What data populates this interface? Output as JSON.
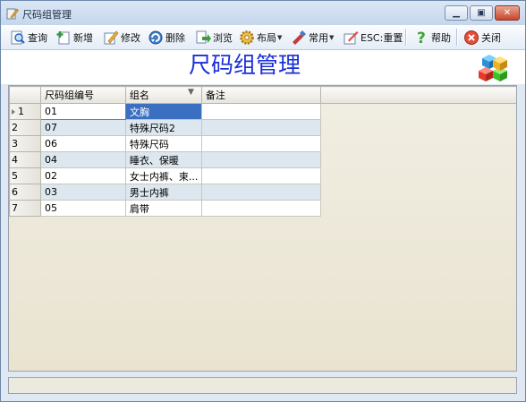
{
  "window": {
    "title": "尺码组管理",
    "app_icon": "pencil-icon"
  },
  "toolbar": {
    "items": [
      {
        "label": "查询",
        "icon": "query-icon"
      },
      {
        "label": "新增",
        "icon": "add-icon"
      },
      {
        "label": "修改",
        "icon": "edit-icon"
      },
      {
        "label": "删除",
        "icon": "delete-icon"
      },
      {
        "label": "浏览",
        "icon": "browse-icon"
      },
      {
        "label": "布局",
        "icon": "layout-gear-icon"
      },
      {
        "label": "常用",
        "icon": "common-icon"
      },
      {
        "label": "ESC:重置",
        "icon": "reset-icon"
      },
      {
        "label": "帮助",
        "icon": "help-icon"
      },
      {
        "label": "关闭",
        "icon": "close-icon"
      }
    ]
  },
  "header": {
    "title": "尺码组管理",
    "logo": "cubes-icon"
  },
  "grid": {
    "columns": [
      "尺码组编号",
      "组名",
      "备注"
    ],
    "rows": [
      {
        "no": "1",
        "code": "01",
        "name": "文胸",
        "note": ""
      },
      {
        "no": "2",
        "code": "07",
        "name": "特殊尺码2",
        "note": ""
      },
      {
        "no": "3",
        "code": "06",
        "name": "特殊尺码",
        "note": ""
      },
      {
        "no": "4",
        "code": "04",
        "name": "睡衣、保暖",
        "note": ""
      },
      {
        "no": "5",
        "code": "02",
        "name": "女士内裤、束...",
        "note": ""
      },
      {
        "no": "6",
        "code": "03",
        "name": "男士内裤",
        "note": ""
      },
      {
        "no": "7",
        "code": "05",
        "name": "肩带",
        "note": ""
      }
    ],
    "selected_row": 1
  },
  "colors": {
    "accent": "#1a2fd8",
    "selection": "#3b6fc2",
    "alt_row": "#dde7ef"
  }
}
